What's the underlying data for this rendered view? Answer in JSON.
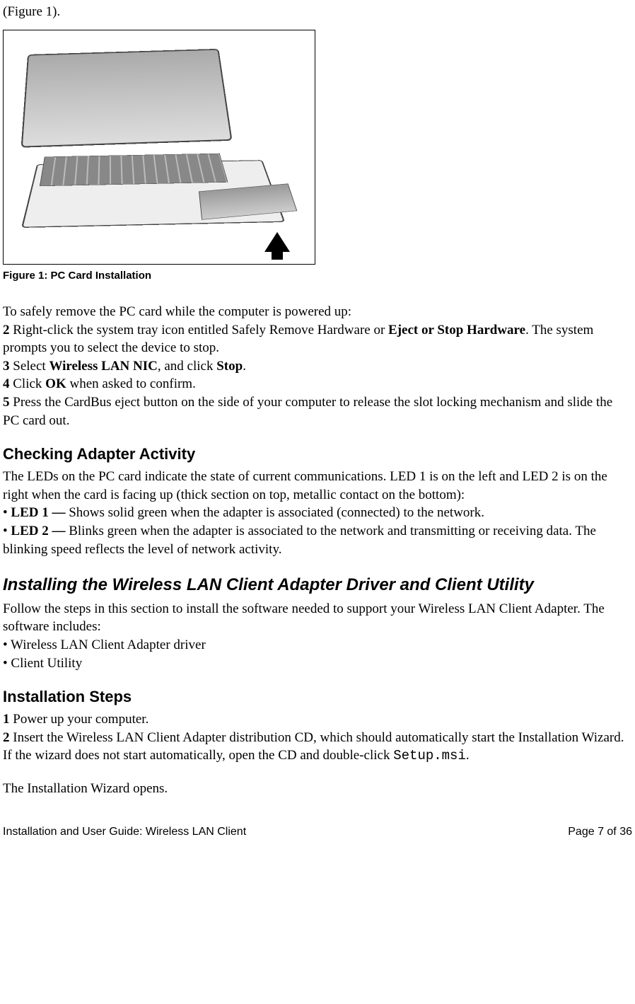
{
  "topline": "(Figure 1).",
  "figure_caption": "Figure 1: PC Card Installation",
  "remove_intro": "To safely remove the PC card while the computer is powered up:",
  "step2": {
    "num": "2",
    "a": " Right-click the system tray icon entitled Safely Remove Hardware or ",
    "b": "Eject or Stop Hardware",
    "c": ". The system prompts you to select the device to stop."
  },
  "step3": {
    "num": "3",
    "a": " Select ",
    "b": "Wireless LAN NIC",
    "c": ", and click ",
    "d": "Stop",
    "e": "."
  },
  "step4": {
    "num": "4",
    "a": " Click ",
    "b": "OK",
    "c": " when asked to confirm."
  },
  "step5": {
    "num": "5",
    "a": " Press the CardBus eject button on the side of your computer to release the slot locking mechanism and slide the PC card out."
  },
  "checking_heading": "Checking Adapter Activity",
  "checking_p1": "The LEDs on the PC card indicate the state of current communications. LED 1 is on the left and LED 2 is on the right when the card is facing up (thick section on top, metallic contact on the bottom):",
  "led1": {
    "bullet": "• ",
    "label": "LED 1 —",
    "text": " Shows solid green when the adapter is associated (connected) to the network."
  },
  "led2": {
    "bullet": "• ",
    "label": "LED 2 —",
    "text": " Blinks green when the adapter is associated to the network and transmitting or receiving data. The blinking speed reflects the level of network activity."
  },
  "installing_heading": " Installing the Wireless LAN Client Adapter Driver and Client Utility",
  "installing_p1": "Follow the steps in this section to install the software needed to support your Wireless LAN Client Adapter. The software includes:",
  "installing_b1": "• Wireless LAN Client Adapter driver",
  "installing_b2": "• Client Utility",
  "install_steps_heading": "Installation Steps",
  "is1": {
    "num": "1",
    "text": " Power up your computer."
  },
  "is2": {
    "num": "2",
    "a": " Insert the Wireless LAN Client Adapter distribution CD, which should automatically start the Installation Wizard. If the wizard does not start automatically, open the CD and double-click ",
    "code": "Setup.msi",
    "b": "."
  },
  "wizard_opens": "The Installation Wizard opens.",
  "footer_left": "Installation and User Guide: Wireless LAN Client",
  "footer_right": "Page 7 of 36"
}
